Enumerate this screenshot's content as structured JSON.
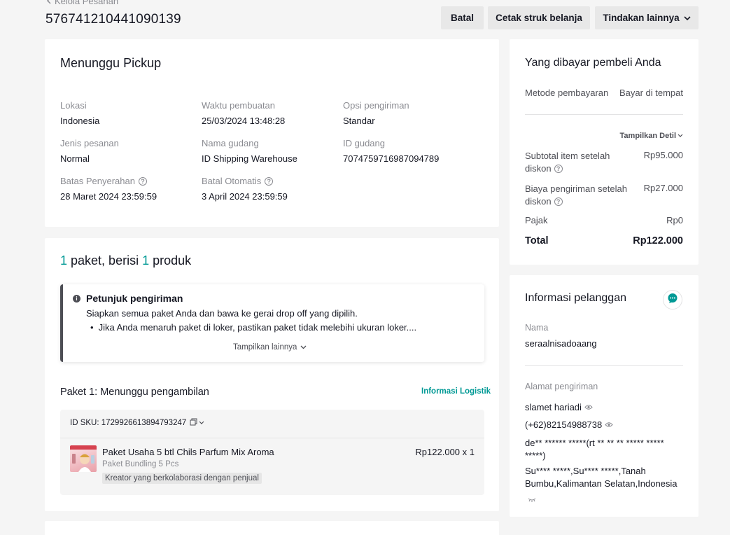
{
  "header": {
    "back_label": "Kelola Pesanan",
    "order_id": "576741210441090139",
    "buttons": {
      "cancel": "Batal",
      "print": "Cetak struk belanja",
      "more": "Tindakan lainnya"
    }
  },
  "status_card": {
    "title": "Menunggu Pickup",
    "fields": {
      "location_label": "Lokasi",
      "location_value": "Indonesia",
      "created_label": "Waktu pembuatan",
      "created_value": "25/03/2024 13:48:28",
      "shipping_option_label": "Opsi pengiriman",
      "shipping_option_value": "Standar",
      "order_type_label": "Jenis pesanan",
      "order_type_value": "Normal",
      "warehouse_name_label": "Nama gudang",
      "warehouse_name_value": "ID Shipping Warehouse",
      "warehouse_id_label": "ID gudang",
      "warehouse_id_value": "7074759716987094789",
      "handover_deadline_label": "Batas Penyerahan",
      "handover_deadline_value": "28 Maret 2024 23:59:59",
      "auto_cancel_label": "Batal Otomatis",
      "auto_cancel_value": "3 April 2024 23:59:59"
    }
  },
  "package_card": {
    "count_packages": "1",
    "text_mid": " paket, berisi ",
    "count_products": "1",
    "text_end": " produk",
    "tip": {
      "title": "Petunjuk pengiriman",
      "line1": "Siapkan semua paket Anda dan bawa ke gerai drop off yang dipilih.",
      "bullet1": "Jika Anda menaruh paket di loker, pastikan paket tidak melebihi ukuran loker....",
      "show_more": "Tampilkan lainnya"
    },
    "package_title": "Paket 1: Menunggu pengambilan",
    "logistics_link": "Informasi Logistik",
    "sku_label": "ID SKU: 1729926613894793247",
    "product": {
      "name": "Paket Usaha 5 btl Chils Parfum Mix Aroma",
      "variant": "Paket Bundling 5 Pcs",
      "tag": "Kreator yang berkolaborasi dengan penjual",
      "price_qty": "Rp122.000 x 1"
    }
  },
  "payment_card": {
    "title": "Yang dibayar pembeli Anda",
    "method_label": "Metode pembayaran",
    "method_value": "Bayar di tempat",
    "show_details": "Tampilkan Detil",
    "subtotal_label_1": "Subtotal item setelah",
    "subtotal_label_2": "diskon",
    "subtotal_value": "Rp95.000",
    "shipping_label_1": "Biaya pengiriman setelah",
    "shipping_label_2": "diskon",
    "shipping_value": "Rp27.000",
    "tax_label": "Pajak",
    "tax_value": "Rp0",
    "total_label": "Total",
    "total_value": "Rp122.000"
  },
  "customer_card": {
    "title": "Informasi pelanggan",
    "name_label": "Nama",
    "name_value": "seraalnisadoaang",
    "address_label": "Alamat pengiriman",
    "recipient": "slamet hariadi",
    "phone": "(+62)82154988738",
    "address_line1": "de** ****** *****(rt ** ** ** ***** *****",
    "address_line2": "*****)",
    "address_line3": "Su**** *****,Su**** *****,Tanah",
    "address_line4": "Bumbu,Kalimantan Selatan,Indonesia"
  },
  "colors": {
    "accent": "#009995",
    "page_bg": "#f5f5f5",
    "button_bg": "#e8e8e8"
  },
  "icons": [
    "chevron-left-icon",
    "chevron-down-icon",
    "help-icon",
    "info-icon",
    "copy-icon",
    "eye-icon",
    "chat-icon"
  ]
}
